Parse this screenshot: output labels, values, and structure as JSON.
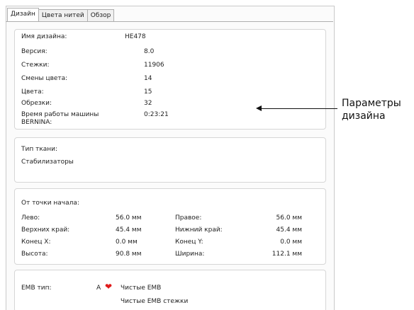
{
  "tabs": [
    {
      "label": "Дизайн"
    },
    {
      "label": "Цвета нитей"
    },
    {
      "label": "Обзор"
    }
  ],
  "design_info": {
    "name_label": "Имя дизайна:",
    "name_value": "HE478",
    "rows": [
      {
        "label": "Версия:",
        "value": "8.0"
      },
      {
        "label": "Стежки:",
        "value": "11906"
      },
      {
        "label": "Смены цвета:",
        "value": "14"
      },
      {
        "label": "Цвета:",
        "value": "15"
      },
      {
        "label": "Обрезки:",
        "value": "32"
      }
    ],
    "machine_time_label_1": "Время работы машины",
    "machine_time_label_2": "BERNINA:",
    "machine_time_value": "0:23:21"
  },
  "fabric": {
    "label": "Тип ткани:",
    "value": "Стабилизаторы"
  },
  "origin": {
    "title": "От точки начала:",
    "rows": [
      {
        "l_label": "Лево:",
        "l_value": "56.0 мм",
        "r_label": "Правое:",
        "r_value": "56.0 мм"
      },
      {
        "l_label": "Верхних край:",
        "l_value": "45.4 мм",
        "r_label": "Нижний край:",
        "r_value": "45.4 мм"
      },
      {
        "l_label": "Конец X:",
        "l_value": "0.0 мм",
        "r_label": "Конец Y:",
        "r_value": "0.0 мм"
      },
      {
        "l_label": "Высота:",
        "l_value": "90.8 мм",
        "r_label": "Ширина:",
        "r_value": "112.1 мм"
      }
    ]
  },
  "emb": {
    "label": "EMB тип:",
    "letter": "A",
    "line1": "Чистые EMB",
    "line2": "Чистые EMB стежки"
  },
  "callout": {
    "line1": "Параметры",
    "line2": "дизайна"
  },
  "colors": {
    "heart": "#e01a1a"
  }
}
